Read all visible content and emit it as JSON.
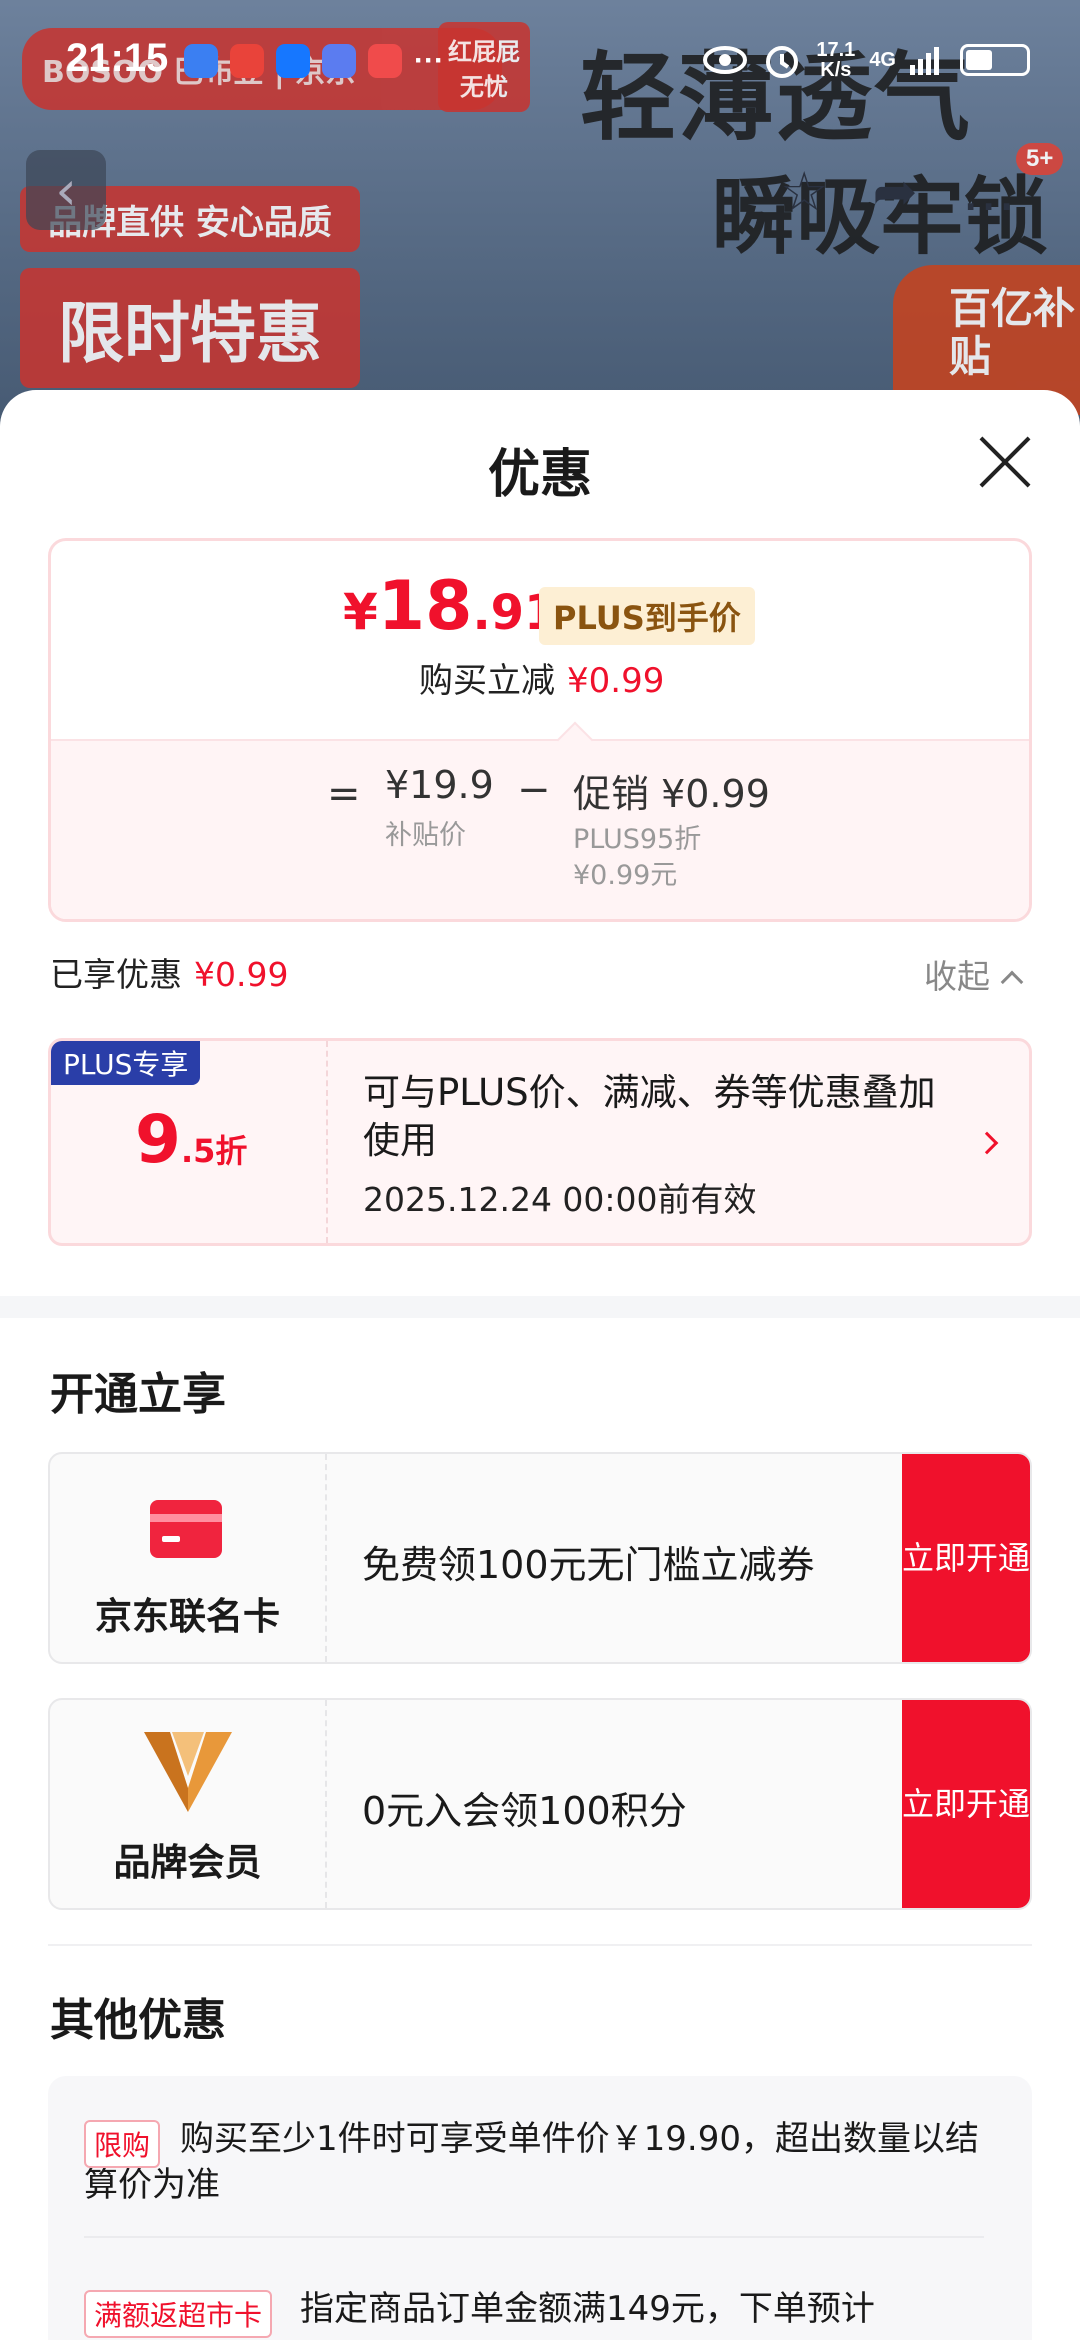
{
  "status_bar": {
    "time": "21:15",
    "more": "···",
    "net_speed_value": "17.1",
    "net_speed_unit": "K/s",
    "network": "4G",
    "icons": [
      "eye-icon",
      "alarm-icon",
      "signal-icon",
      "battery-icon"
    ]
  },
  "background": {
    "brand_pill": "BOSOO 巴布豆 | 京东",
    "tag_redbutt": "红屁屁无忧",
    "headline_1": "轻薄透气",
    "headline_2": "瞬吸牢锁",
    "tag_brand_direct": "品牌直供 安心品质",
    "tag_limited": "限时特惠",
    "subsidy_badge": "百亿补贴",
    "badge_count": "5+"
  },
  "sheet": {
    "title": "优惠",
    "price_card": {
      "currency": "¥",
      "price_int": "18",
      "price_dec": ".91",
      "plus_tag": "PLUS到手价",
      "reduce_label": "购买立减",
      "reduce_amount": "¥0.99",
      "equals": "=",
      "subsidy_price": "¥19.9",
      "subsidy_label": "补贴价",
      "minus": "−",
      "promo_price": "促销 ¥0.99",
      "promo_detail_1": "PLUS95折",
      "promo_detail_2": "¥0.99元"
    },
    "enjoyed_label": "已享优惠",
    "enjoyed_amount": "¥0.99",
    "collapse_label": "收起",
    "plus_coupon": {
      "flag": "PLUS专享",
      "discount_big": "9",
      "discount_small": ".5折",
      "desc": "可与PLUS价、满减、券等优惠叠加使用",
      "valid": "2025.12.24 00:00前有效"
    },
    "open_section": {
      "title": "开通立享",
      "offers": [
        {
          "name": "京东联名卡",
          "text": "免费领100元无门槛立减券",
          "button": "立即开通"
        },
        {
          "name": "品牌会员",
          "text": "0元入会领100积分",
          "button": "立即开通"
        }
      ]
    },
    "other_section": {
      "title": "其他优惠",
      "items": [
        {
          "tag": "限购",
          "text": "购买至少1件时可享受单件价￥19.90，超出数量以结算价为准"
        },
        {
          "tag": "满额返超市卡",
          "text": "指定商品订单金额满149元，下单预计"
        }
      ]
    }
  },
  "colors": {
    "accent_red": "#f0112c",
    "plus_blue": "#2a3ea8",
    "plus_gold_bg": "#fdefd4"
  }
}
